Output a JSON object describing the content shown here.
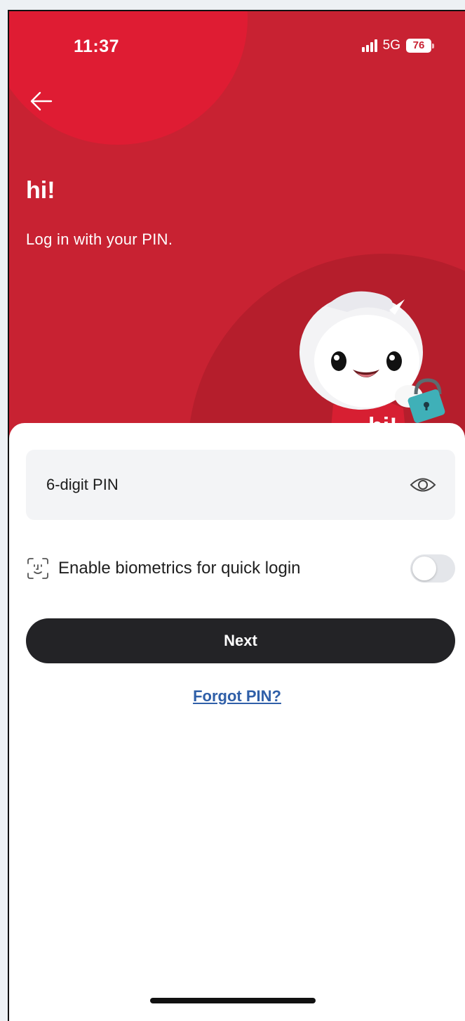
{
  "status_bar": {
    "time": "11:37",
    "network": "5G",
    "battery": "76"
  },
  "header": {
    "greeting": "hi!",
    "subtitle": "Log in with your PIN.",
    "mascot_badge": "hi!"
  },
  "form": {
    "pin_placeholder": "6-digit PIN",
    "biometrics_label": "Enable biometrics for quick login",
    "biometrics_enabled": false,
    "next_label": "Next",
    "forgot_label": "Forgot PIN?"
  },
  "colors": {
    "brand_red": "#c82232",
    "button_dark": "#232326",
    "link_blue": "#2f5fa8"
  },
  "icons": {
    "back": "arrow-left",
    "eye": "eye",
    "face": "face-id",
    "lock": "padlock"
  }
}
